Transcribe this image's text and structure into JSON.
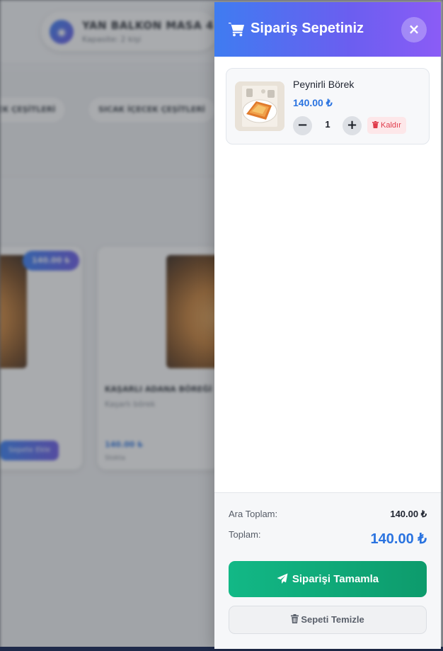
{
  "background": {
    "table_name": "YAN BALKON MASA 4",
    "table_sub": "Kapasite: 2 kişi",
    "categories": [
      "ATLIMA İÇECEK ÇEŞİTLERİ",
      "SICAK İÇECEK ÇEŞİTLERİ"
    ],
    "card1_badge": "140.00 ₺",
    "card1_button": "Sepete Ekle",
    "card2_title": "KAŞARLI ADANA BÖREĞİ",
    "card2_desc": "Kaşarlı börek",
    "card2_price": "140.00 ₺",
    "card2_status": "Stokta"
  },
  "cart": {
    "title": "Sipariş Sepetiniz",
    "close_icon": "×",
    "items": [
      {
        "name": "Peynirli Börek",
        "price": "140.00 ₺",
        "quantity": "1",
        "decrement": "−",
        "increment": "+",
        "remove_label": "Kaldır"
      }
    ],
    "summary": {
      "subtotal_label": "Ara Toplam:",
      "subtotal_value": "140.00 ₺",
      "total_label": "Toplam:",
      "total_value": "140.00 ₺"
    },
    "checkout_label": "Siparişi Tamamla",
    "clear_label": "Sepeti Temizle"
  },
  "colors": {
    "header_gradient_start": "#3f7cf1",
    "header_gradient_end": "#8b5cf6",
    "price_blue": "#2a73e0",
    "checkout_green": "#12b886",
    "remove_red": "#e03b4b"
  }
}
